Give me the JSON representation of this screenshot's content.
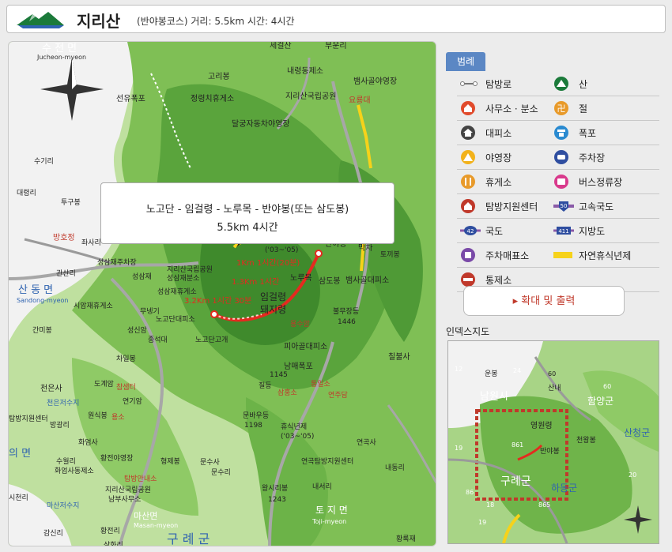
{
  "header": {
    "title": "지리산",
    "subtitle": "(반야봉코스) 거리: 5.5km  시간: 4시간"
  },
  "popup": {
    "line1": "노고단 - 임걸령 - 노루목 - 반야봉(또는 삼도봉)",
    "line2": "5.5km 4시간"
  },
  "map_labels": {
    "l01": "수 전 면",
    "l02": "Jucheon-myeon",
    "l03": "세걸산",
    "l04": "부운리",
    "l05": "고리봉",
    "l06": "내령동제소",
    "l07": "뱀사골야영장",
    "l08": "선유폭포",
    "l09": "정령치휴게소",
    "l10": "지리산국립공원",
    "l11": "달궁자동차야영장",
    "l12": "요룡대",
    "l13": "수기리",
    "l14": "대령리",
    "l15": "투구봉",
    "l16": "고리봉",
    "l17": "심원",
    "l18": "좌사리",
    "l19": "용소",
    "l20": "휴식년제",
    "l21": "('03~'05)",
    "l22": "반야봉",
    "l23": "중봉",
    "l24": "간장소",
    "l25": "막차",
    "l26": "토끼봉",
    "l27": "방호정",
    "l28": "좌사리",
    "l29": "성삼재주차장",
    "l30": "성삼재",
    "l31": "지리산국립공원",
    "l32": "성삼재분소",
    "l33": "1Km 1시간(20분)",
    "l34": "1.3Km 1시간",
    "l35": "노루목",
    "l36": "삼도봉",
    "l37": "뱀사골대피소",
    "l38": "관산리",
    "l39": "산 동 면",
    "l40": "Sandong-myeon",
    "l41": "시암재휴게소",
    "l42": "성삼재휴게소",
    "l43": "무넹기",
    "l44": "노고단대피소",
    "l45": "3.2Km 1시간 30분",
    "l46": "임걸령",
    "l47": "돼지령",
    "l48": "불무장등",
    "l49": "1446",
    "l50": "용수암",
    "l51": "성신암",
    "l52": "종석대",
    "l53": "노고단고개",
    "l54": "피아골대피소",
    "l55": "간미봉",
    "l56": "차일봉",
    "l57": "남매폭포",
    "l58": "칠불사",
    "l59": "1145",
    "l60": "질등",
    "l61": "천은사",
    "l62": "도계암",
    "l63": "참샘터",
    "l64": "삼홍소",
    "l65": "통일소",
    "l66": "연주담",
    "l67": "연기암",
    "l68": "천은저수지",
    "l69": "원식봉",
    "l70": "용소",
    "l71": "탐방지원센터",
    "l72": "방광리",
    "l73": "화엄사",
    "l74": "문바우등",
    "l75": "1198",
    "l76": "휴식년제",
    "l77": "('03~'05)",
    "l78": "연곡사",
    "l79": "의 면",
    "l80": "수월리",
    "l81": "황전야영장",
    "l82": "형제봉",
    "l83": "문수사",
    "l84": "화엄사동제소",
    "l85": "탐방안내소",
    "l86": "지리산국립공원",
    "l87": "남부사무소",
    "l88": "문수리",
    "l89": "연곡탐방지원센터",
    "l90": "내동리",
    "l91": "내서리",
    "l92": "마산저수지",
    "l93": "왕시리봉",
    "l94": "1243",
    "l95": "마산면",
    "l96": "Masan-myeon",
    "l97": "토 지 면",
    "l98": "Toji-myeon",
    "l99": "감신리",
    "l100": "황전리",
    "l101": "구   례   군",
    "l102": "황록재",
    "l103": "시천리",
    "l104": "삼화리"
  },
  "legend": {
    "tab": "범례",
    "items": [
      {
        "label": "탐방로",
        "icon": "trail-icon"
      },
      {
        "label": "산",
        "icon": "mountain-icon"
      },
      {
        "label": "사무소 · 분소",
        "icon": "office-icon"
      },
      {
        "label": "절",
        "icon": "temple-icon"
      },
      {
        "label": "대피소",
        "icon": "shelter-icon"
      },
      {
        "label": "폭포",
        "icon": "waterfall-icon"
      },
      {
        "label": "야영장",
        "icon": "campsite-icon"
      },
      {
        "label": "주차장",
        "icon": "parking-icon"
      },
      {
        "label": "휴게소",
        "icon": "rest-area-icon"
      },
      {
        "label": "버스정류장",
        "icon": "bus-stop-icon"
      },
      {
        "label": "탐방지원센터",
        "icon": "visitor-center-icon"
      },
      {
        "label": "고속국도",
        "icon": "expressway-icon"
      },
      {
        "label": "국도",
        "icon": "national-road-icon"
      },
      {
        "label": "지방도",
        "icon": "local-road-icon"
      },
      {
        "label": "주차매표소",
        "icon": "ticket-office-icon"
      },
      {
        "label": "자연휴식년제",
        "icon": "rest-year-icon"
      },
      {
        "label": "통제소",
        "icon": "checkpoint-icon"
      }
    ],
    "road_numbers": {
      "expressway": "50",
      "national": "42",
      "local": "411"
    }
  },
  "print_button": "확대 및 출력",
  "index_map": {
    "title": "인덱스지도",
    "labels": [
      "남원시",
      "운봉",
      "24",
      "60",
      "산내",
      "60",
      "함양군",
      "12",
      "영원령",
      "천왕봉",
      "산청군",
      "19",
      "861",
      "반야봉",
      "구례군",
      "하동군",
      "20",
      "86",
      "18",
      "19",
      "865"
    ]
  },
  "colors": {
    "accent": "#5b87c4",
    "route": "#e42a1f",
    "rest_year": "#f6d21a",
    "forest": "#6fb44a",
    "lowland": "#b9dc98"
  }
}
